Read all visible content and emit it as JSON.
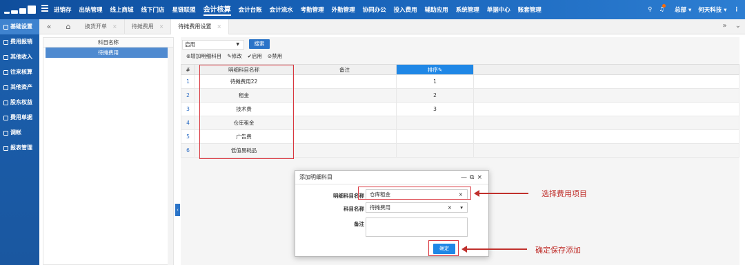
{
  "topnav": {
    "items": [
      "进销存",
      "出纳管理",
      "线上商城",
      "线下门店",
      "星链联盟",
      "会计核算",
      "会计台账",
      "会计流水",
      "考勤管理",
      "外勤管理",
      "协同办公",
      "投入费用",
      "辅助应用",
      "系统管理",
      "单据中心",
      "账套管理"
    ],
    "active": "会计核算",
    "org": "总部 ▾",
    "company": "何天科技 ▾"
  },
  "sidebar": {
    "items": [
      "基础设置",
      "费用报销",
      "其他收入",
      "往来核算",
      "其他资产",
      "股东权益",
      "费用单据",
      "调帐",
      "报表管理"
    ]
  },
  "tabs": {
    "items": [
      {
        "label": "换货开单"
      },
      {
        "label": "待摊费用"
      },
      {
        "label": "待摊费用设置"
      }
    ]
  },
  "left": {
    "header": "科目名称",
    "row": "待摊费用"
  },
  "filter": {
    "status": "启用",
    "search": "搜索"
  },
  "toolbar": {
    "add": "⊕增加明细科目",
    "edit": "✎修改",
    "enable": "✔启用",
    "disable": "⊘禁用"
  },
  "grid": {
    "headers": [
      "#",
      "明细科目名称",
      "备注",
      "排序✎"
    ],
    "rows": [
      {
        "no": "1",
        "name": "待摊费用22",
        "remark": "",
        "sort": "1"
      },
      {
        "no": "2",
        "name": "租金",
        "remark": "",
        "sort": "2"
      },
      {
        "no": "3",
        "name": "技术费",
        "remark": "",
        "sort": "3"
      },
      {
        "no": "4",
        "name": "仓库租金",
        "remark": "",
        "sort": ""
      },
      {
        "no": "5",
        "name": "广告费",
        "remark": "",
        "sort": ""
      },
      {
        "no": "6",
        "name": "低值易耗品",
        "remark": "",
        "sort": ""
      }
    ]
  },
  "dialog": {
    "title": "添加明细科目",
    "detail_label": "明细科目名称",
    "detail_value": "仓库租金",
    "subject_label": "科目名称",
    "subject_value": "待摊费用",
    "remark_label": "备注",
    "ok": "确定"
  },
  "annotations": {
    "select": "选择费用项目",
    "confirm": "确定保存添加"
  },
  "colors": {
    "topbar": "#1762b8",
    "accent": "#1f87e6",
    "highlight": "#d9363e"
  }
}
